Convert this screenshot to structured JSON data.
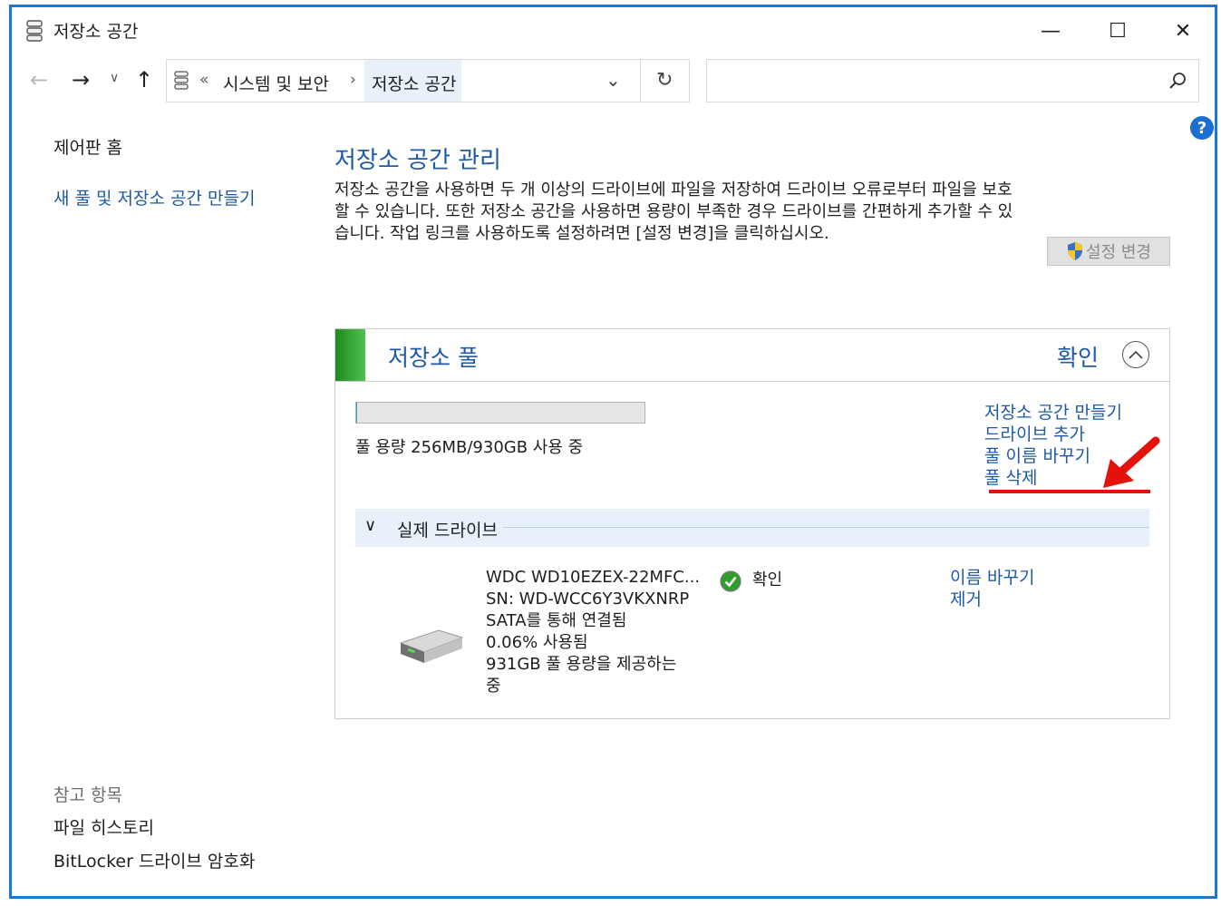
{
  "window": {
    "title": "저장소 공간",
    "min_glyph": "—",
    "max_glyph": "☐",
    "close_glyph": "✕"
  },
  "nav": {
    "breadcrumb_overflow": "«",
    "breadcrumb": [
      "시스템 및 보안",
      "저장소 공간"
    ],
    "breadcrumb_sep": "›",
    "search_placeholder": ""
  },
  "left": {
    "home": "제어판 홈",
    "new_pool": "새 풀 및 저장소 공간 만들기",
    "see_also_title": "참고 항목",
    "see_also": [
      "파일 히스토리",
      "BitLocker 드라이브 암호화"
    ]
  },
  "main": {
    "title": "저장소 공간 관리",
    "description": "저장소 공간을 사용하면 두 개 이상의 드라이브에 파일을 저장하여 드라이브 오류로부터 파일을 보호할 수 있습니다. 또한 저장소 공간을 사용하면 용량이 부족한 경우 드라이브를 간편하게 추가할 수 있습니다. 작업 링크를 사용하도록 설정하려면 [설정 변경]을 클릭하십시오.",
    "settings_button": "설정 변경"
  },
  "pool": {
    "title": "저장소 풀",
    "status": "확인",
    "usage_fraction": 0.0003,
    "capacity_text": "풀 용량 256MB/930GB 사용 중",
    "links": [
      "저장소 공간 만들기",
      "드라이브 추가",
      "풀 이름 바꾸기",
      "풀 삭제"
    ],
    "physical_drives_title": "실제 드라이브"
  },
  "drive": {
    "lines": [
      "WDC WD10EZEX-22MFC...",
      "SN: WD-WCC6Y3VKXNRP",
      "SATA를 통해 연결됨",
      "0.06% 사용됨",
      "931GB 풀 용량을 제공하는",
      "중"
    ],
    "status": "확인",
    "links": [
      "이름 바꾸기",
      "제거"
    ]
  },
  "colors": {
    "link": "#1e5aa8",
    "window_border": "#1e78c8",
    "annotation": "#e3120b",
    "pool_accent": "#2e9e2e"
  }
}
